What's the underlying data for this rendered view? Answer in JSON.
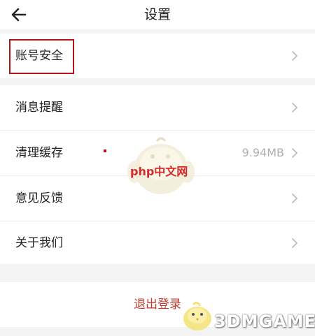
{
  "header": {
    "title": "设置",
    "back_icon": "arrow-left-icon"
  },
  "settings": {
    "items": [
      {
        "label": "账号安全",
        "value": ""
      },
      {
        "label": "消息提醒",
        "value": ""
      },
      {
        "label": "清理缓存",
        "value": "9.94MB"
      },
      {
        "label": "意见反馈",
        "value": ""
      },
      {
        "label": "关于我们",
        "value": ""
      }
    ]
  },
  "logout": {
    "label": "退出登录"
  },
  "watermarks": {
    "php_site": "php中文网",
    "game_site": "3DMGAME"
  },
  "colors": {
    "highlight": "#b5131a",
    "logout": "#c0392b",
    "background": "#f3f3f3"
  }
}
